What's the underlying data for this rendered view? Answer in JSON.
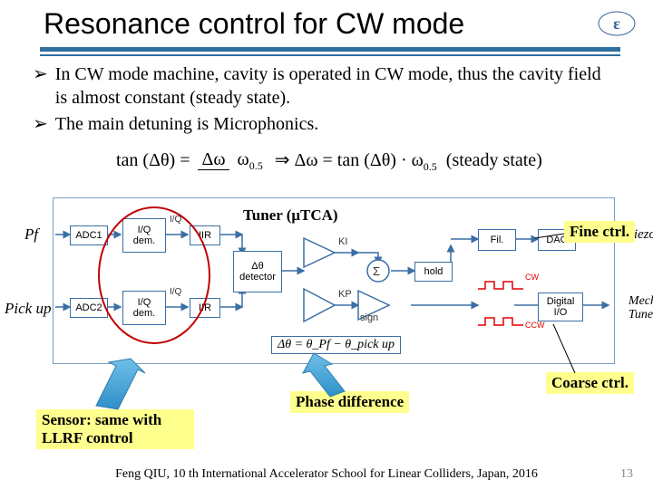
{
  "title": "Resonance control for CW mode",
  "bullets": [
    "In CW mode machine, cavity is operated in CW mode, thus the cavity field is almost constant (steady state).",
    "The main detuning is Microphonics."
  ],
  "bullet_marker": "➢",
  "equation": {
    "lhs": "tan (Δθ) =",
    "frac_num": "Δω",
    "frac_den": "ω",
    "den_sub": "0.5",
    "implies": "⇒",
    "rhs1": "Δω = tan (Δθ) · ω",
    "rhs_sub": "0.5",
    "tail": "(steady state)"
  },
  "labels": {
    "tuner": "Tuner (μTCA)",
    "fine": "Fine ctrl.",
    "coarse": "Coarse ctrl.",
    "phase_diff": "Phase difference",
    "sensor": "Sensor: same with LLRF control"
  },
  "diagram": {
    "pf": "Pf",
    "pickup": "Pick up",
    "adc1": "ADC1",
    "adc2": "ADC2",
    "iq": "I/Q\ndem.",
    "iq_tiny": "I/Q",
    "iir": "IIR",
    "dth_det": "Δθ\ndetector",
    "KI": "KI",
    "KP": "KP",
    "sigma": "Σ",
    "hold": "hold",
    "sign": "sign",
    "fil": "Fil.",
    "dac": "DAC",
    "dio": "Digital\nI/O",
    "piezo": "Piezo",
    "mech": "Mechanical\nTuner",
    "cw": "CW",
    "ccw": "CCW",
    "eq2": "Δθ = θ_Pf − θ_pick up"
  },
  "footer": "Feng QIU, 10 th International Accelerator School for Linear Colliders, Japan, 2016",
  "page_number": "13"
}
